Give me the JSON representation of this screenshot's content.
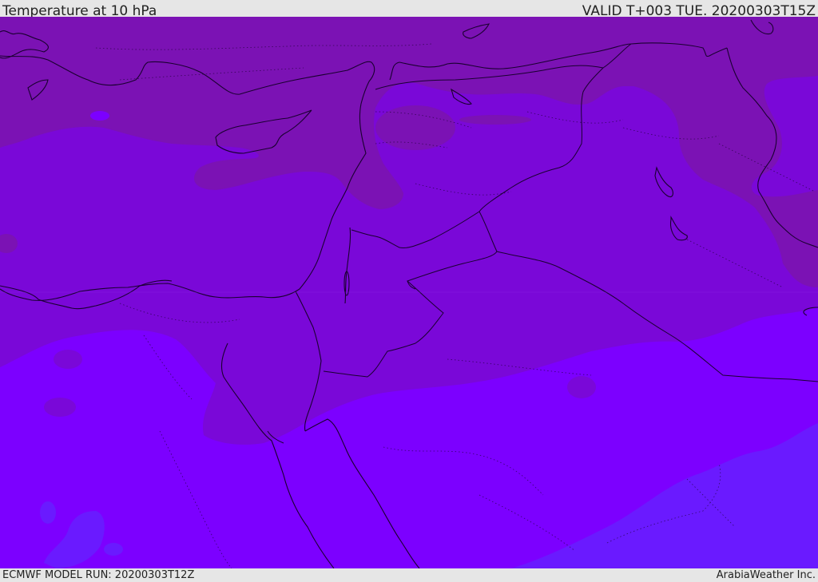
{
  "header": {
    "title": "Temperature at 10 hPa",
    "valid_time": "VALID T+003 TUE. 20200303T15Z"
  },
  "footer": {
    "model_run": "ECMWF MODEL RUN: 20200303T12Z",
    "credit": "ArabiaWeather Inc."
  },
  "map": {
    "colors": {
      "warm_band": "#7b12b4",
      "mid_band": "#7a08d8",
      "cool_band": "#7c00ff",
      "coldest_band": "#6a1aff",
      "border_line": "#1a0030"
    }
  }
}
